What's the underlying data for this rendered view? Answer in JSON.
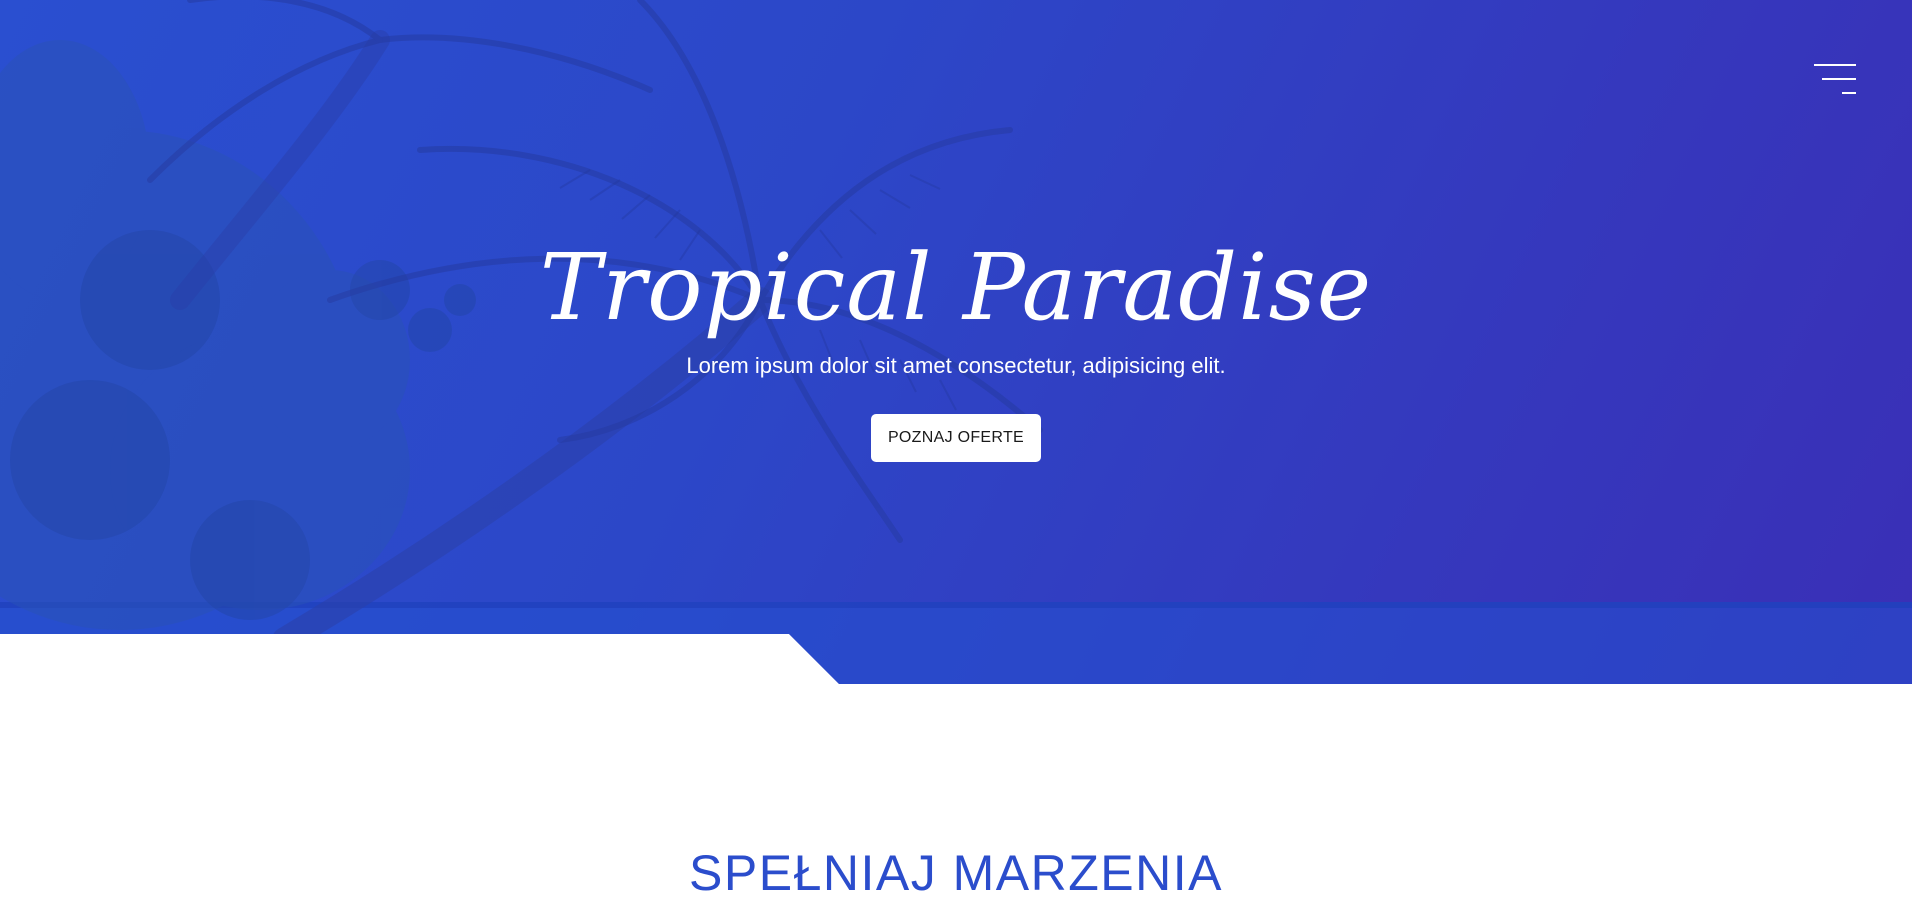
{
  "header": {
    "menu_icon": "hamburger-menu-icon"
  },
  "hero": {
    "title": "Tropical Paradise",
    "subtitle": "Lorem ipsum dolor sit amet consectetur, adipisicing elit.",
    "cta_label": "POZNAJ OFERTE"
  },
  "section": {
    "title": "SPEŁNIAJ MARZENIA"
  },
  "colors": {
    "hero_overlay": "#2c47c8",
    "accent": "#2b4dcc",
    "button_bg": "#ffffff",
    "text_light": "#ffffff"
  }
}
